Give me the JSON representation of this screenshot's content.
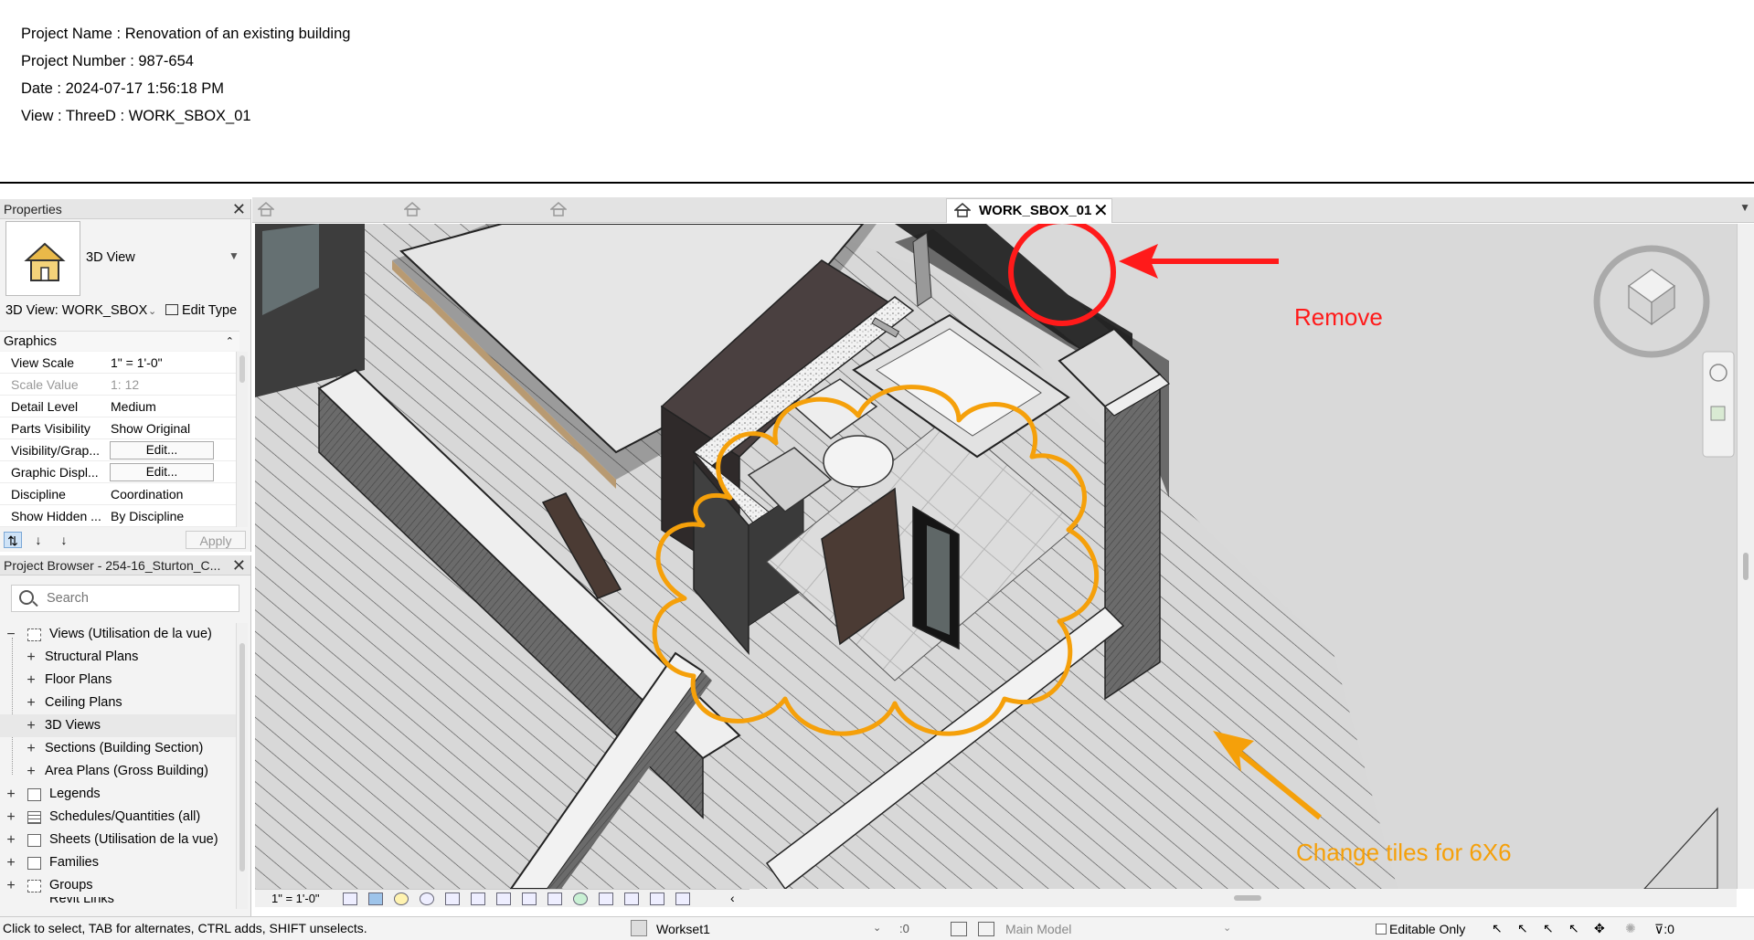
{
  "header": {
    "project_name": "Project Name : Renovation of an existing building",
    "project_number": "Project Number : 987-654",
    "date": "Date : 2024-07-17 1:56:18 PM",
    "view": "View : ThreeD : WORK_SBOX_01"
  },
  "properties": {
    "title": "Properties",
    "type_name": "3D View",
    "view_selector": "3D View: WORK_SBOX",
    "edit_type": "Edit Type",
    "section": "Graphics",
    "rows": [
      {
        "key": "View Scale",
        "value": "1\" = 1'-0\""
      },
      {
        "key": "Scale Value",
        "value": "1:  12"
      },
      {
        "key": "Detail Level",
        "value": "Medium"
      },
      {
        "key": "Parts Visibility",
        "value": "Show Original"
      },
      {
        "key": "Visibility/Grap...",
        "value": "Edit..."
      },
      {
        "key": "Graphic Displ...",
        "value": "Edit..."
      },
      {
        "key": "Discipline",
        "value": "Coordination"
      },
      {
        "key": "Show Hidden ...",
        "value": "By Discipline"
      }
    ],
    "apply": "Apply"
  },
  "project_browser": {
    "title": "Project Browser - 254-16_Sturton_C...",
    "search_placeholder": "Search",
    "items": [
      {
        "label": "Views (Utilisation de la vue)",
        "expander": "−"
      },
      {
        "label": "Structural Plans",
        "expander": "+"
      },
      {
        "label": "Floor Plans",
        "expander": "+"
      },
      {
        "label": "Ceiling Plans",
        "expander": "+"
      },
      {
        "label": "3D Views",
        "expander": "+"
      },
      {
        "label": "Sections (Building Section)",
        "expander": "+"
      },
      {
        "label": "Area Plans (Gross Building)",
        "expander": "+"
      },
      {
        "label": "Legends",
        "expander": "+"
      },
      {
        "label": "Schedules/Quantities (all)",
        "expander": "+"
      },
      {
        "label": "Sheets (Utilisation de la vue)",
        "expander": "+"
      },
      {
        "label": "Families",
        "expander": "+"
      },
      {
        "label": "Groups",
        "expander": "+"
      },
      {
        "label": "Revit Links",
        "expander": ""
      }
    ]
  },
  "tabs": {
    "active": "WORK_SBOX_01"
  },
  "view_controls": {
    "scale": "1\" = 1'-0\""
  },
  "annotations": {
    "remove": "Remove",
    "tiles": "Change tiles for 6X6"
  },
  "status_bar": {
    "message": "Click to select, TAB for alternates, CTRL adds, SHIFT unselects.",
    "workset": "Workset1",
    "workset_count": ":0",
    "design_option": "Main Model",
    "editable_only": "Editable Only",
    "filter_count": ":0"
  },
  "colors": {
    "remove_red": "#ff1a1a",
    "tiles_orange": "#f5a00a"
  }
}
